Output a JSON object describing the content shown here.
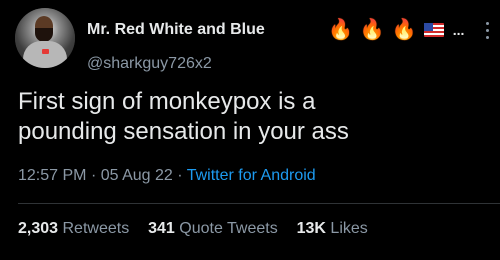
{
  "tweet": {
    "display_name": "Mr. Red White and Blue",
    "handle": "@sharkguy726x2",
    "name_suffix": "...",
    "text": "First sign of monkeypox is a\npounding sensation in your ass",
    "time": "12:57 PM",
    "date": "05 Aug 22",
    "separator": "·",
    "source": "Twitter for Android",
    "stats": {
      "retweets_count": "2,303",
      "retweets_label": "Retweets",
      "quote_tweets_count": "341",
      "quote_tweets_label": "Quote Tweets",
      "likes_count": "13K",
      "likes_label": "Likes"
    }
  },
  "icons": {
    "fire": "fire-emoji",
    "flag": "us-flag-emoji",
    "more": "more-options-icon",
    "avatar": "profile-avatar"
  },
  "colors": {
    "background": "#000000",
    "primary_text": "#e7e9ea",
    "secondary_text": "#8b98a5",
    "link": "#1d9bf0"
  }
}
